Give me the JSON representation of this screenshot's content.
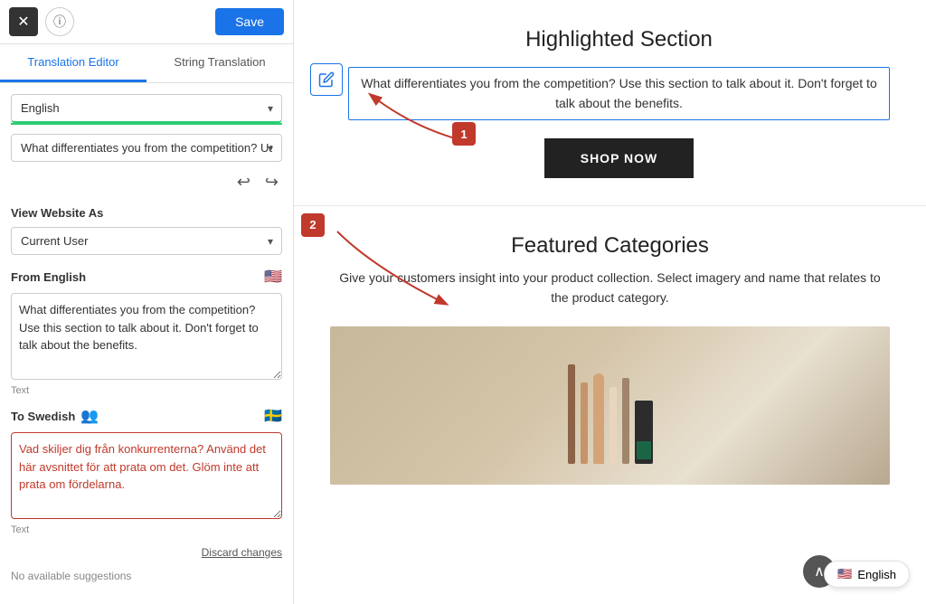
{
  "topBar": {
    "closeLabel": "✕",
    "infoLabel": "ⓘ",
    "saveLabel": "Save"
  },
  "tabs": [
    {
      "id": "translation-editor",
      "label": "Translation Editor",
      "active": true
    },
    {
      "id": "string-translation",
      "label": "String Translation",
      "active": false
    }
  ],
  "languageDropdown": {
    "value": "English",
    "placeholder": "English"
  },
  "stringDropdown": {
    "value": "What differentiates you from the competition? Use...",
    "placeholder": "What differentiates you from the competition? Use..."
  },
  "viewSection": {
    "title": "View Website As",
    "currentUserLabel": "Current User"
  },
  "fromSection": {
    "label": "From English",
    "flag": "🇺🇸",
    "text": "What differentiates you from the competition? Use this section to talk about it. Don't forget to talk about the benefits.",
    "textareaLabel": "Text"
  },
  "toSection": {
    "label": "To Swedish",
    "flag": "🇸🇪",
    "text": "Vad skiljer dig från konkurrenterna? Använd det här avsnittet för att prata om det. Glöm inte att prata om fördelarna.",
    "textareaLabel": "Text",
    "discardLabel": "Discard changes",
    "noSuggestions": "No available suggestions"
  },
  "rightPanel": {
    "highlightedSection": {
      "title": "Highlighted Section",
      "bodyText": "What differentiates you from the competition? Use this section to talk about it. Don't forget to talk about the benefits.",
      "shopNowLabel": "SHOP NOW"
    },
    "featuredSection": {
      "title": "Featured Categories",
      "description": "Give your customers insight into your product collection. Select imagery and name that relates to the product category."
    }
  },
  "languageBadge": {
    "flag": "🇺🇸",
    "label": "English"
  },
  "scrollTopLabel": "∧"
}
